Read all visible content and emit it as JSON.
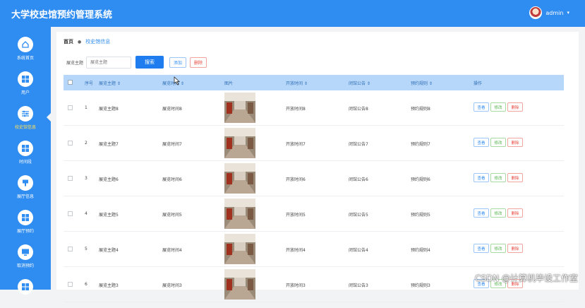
{
  "app": {
    "title": "大学校史馆预约管理系统"
  },
  "user": {
    "name": "admin"
  },
  "sidebar": {
    "items": [
      {
        "label": "系统首页",
        "icon": "home-icon",
        "active": false
      },
      {
        "label": "用户",
        "icon": "grid-icon",
        "active": false
      },
      {
        "label": "校史馆信息",
        "icon": "sliders-icon",
        "active": true
      },
      {
        "label": "时间段",
        "icon": "grid-icon",
        "active": false
      },
      {
        "label": "展厅信息",
        "icon": "stamp-icon",
        "active": false
      },
      {
        "label": "展厅预约",
        "icon": "grid-icon",
        "active": false
      },
      {
        "label": "取消预约",
        "icon": "monitor-icon",
        "active": false
      }
    ]
  },
  "breadcrumb": {
    "home": "首页",
    "separator": "●",
    "current": "校史馆信息"
  },
  "search": {
    "label": "展览主题",
    "placeholder": "展览主题",
    "button": "搜索",
    "add": "添加",
    "delete": "删除"
  },
  "table": {
    "headers": [
      "序号",
      "展览主题 ⇕",
      "展览时间 ⇕",
      "图片",
      "开放时间 ⇕",
      "闭馆公告 ⇕",
      "预约规则 ⇕",
      "操作"
    ],
    "actions": {
      "view": "查看",
      "edit": "修改",
      "delete": "删除"
    },
    "rows": [
      {
        "index": "1",
        "theme": "展览主题8",
        "time": "展览时间8",
        "open": "开放时间8",
        "notice": "闭馆公告8",
        "rule": "预约规则8"
      },
      {
        "index": "2",
        "theme": "展览主题7",
        "time": "展览时间7",
        "open": "开放时间7",
        "notice": "闭馆公告7",
        "rule": "预约规则7"
      },
      {
        "index": "3",
        "theme": "展览主题6",
        "time": "展览时间6",
        "open": "开放时间6",
        "notice": "闭馆公告6",
        "rule": "预约规则6"
      },
      {
        "index": "4",
        "theme": "展览主题5",
        "time": "展览时间5",
        "open": "开放时间5",
        "notice": "闭馆公告5",
        "rule": "预约规则5"
      },
      {
        "index": "5",
        "theme": "展览主题4",
        "time": "展览时间4",
        "open": "开放时间4",
        "notice": "闭馆公告4",
        "rule": "预约规则4"
      },
      {
        "index": "6",
        "theme": "展览主题3",
        "time": "展览时间3",
        "open": "开放时间3",
        "notice": "闭馆公告3",
        "rule": "预约规则3"
      }
    ]
  },
  "watermark": "CSDN @计算机毕设工作室",
  "colors": {
    "primary": "#2f8cf0",
    "header_row": "#b7d7fa",
    "danger": "#e8463c",
    "success": "#52b44a"
  }
}
